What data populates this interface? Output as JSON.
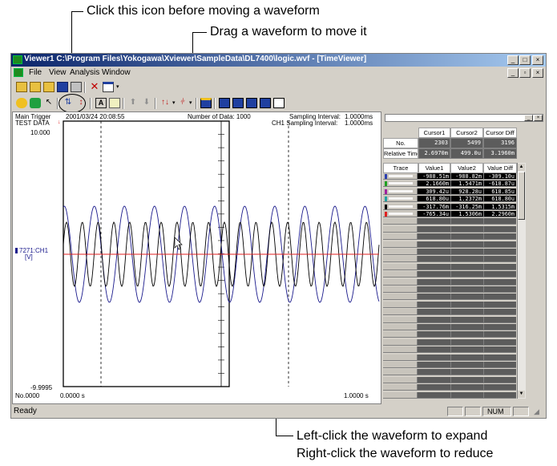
{
  "annotations": {
    "icon_hint": "Click this icon before moving a waveform",
    "drag_hint": "Drag a waveform to move it",
    "expand_hint": "Left-click the waveform to expand",
    "reduce_hint": "Right-click the waveform to reduce"
  },
  "window": {
    "title": "Viewer1 C:\\Program Files\\Yokogawa\\Xviewer\\SampleData\\DL7400\\logic.wvf - [TimeViewer]",
    "menu": [
      "File",
      "View",
      "Analysis",
      "Window"
    ]
  },
  "plot": {
    "main_trigger": "Main Trigger",
    "date": "2001/03/24 20:08:55",
    "test_data": "TEST DATA",
    "number_of_data": "Number of Data: 1000",
    "sampling_interval_label": "Sampling Interval:",
    "sampling_interval_value": "1.0000ms",
    "ch1_sampling_label": "CH1 Sampling Interval:",
    "ch1_sampling_value": "1.0000ms",
    "y_max": "10.000",
    "y_min": "-9.9995",
    "channel_label": "7271:CH1",
    "channel_unit": "[V]",
    "record_no": "No.0000",
    "x_start": "0.0000 s",
    "x_end": "1.0000 s",
    "colors": {
      "wave_dark": "#000000",
      "wave_blue": "#1a1a8c",
      "zero_line": "#e02020"
    }
  },
  "panel": {
    "headers": [
      "Cursor1",
      "Cursor2",
      "Cursor Diff"
    ],
    "no_label": "No.",
    "no_values": [
      "2303",
      "5499",
      "3196"
    ],
    "rel_label": "Relative Time",
    "rel_values": [
      "2.6970m",
      "499.0u",
      "3.1960m"
    ],
    "trace_headers": [
      "Trace",
      "Value1",
      "Value2",
      "Value Diff"
    ],
    "rows": [
      {
        "color": "#2a3fb0",
        "v1": "-988.51m",
        "v2": "-988.82m",
        "diff": "-309.10u"
      },
      {
        "color": "#20a020",
        "v1": "2.1660m",
        "v2": "1.5471m",
        "diff": "-618.87u"
      },
      {
        "color": "#a020a0",
        "v1": "309.42u",
        "v2": "928.28u",
        "diff": "618.85u"
      },
      {
        "color": "#20a0a0",
        "v1": "618.80u",
        "v2": "1.2372m",
        "diff": "618.80u"
      },
      {
        "color": "#000000",
        "v1": "-317.76m",
        "v2": "-316.25m",
        "diff": "1.5315m"
      },
      {
        "color": "#e02020",
        "v1": "-765.34u",
        "v2": "1.5306m",
        "diff": "2.2960m"
      }
    ]
  },
  "status": {
    "ready": "Ready",
    "num": "NUM"
  }
}
